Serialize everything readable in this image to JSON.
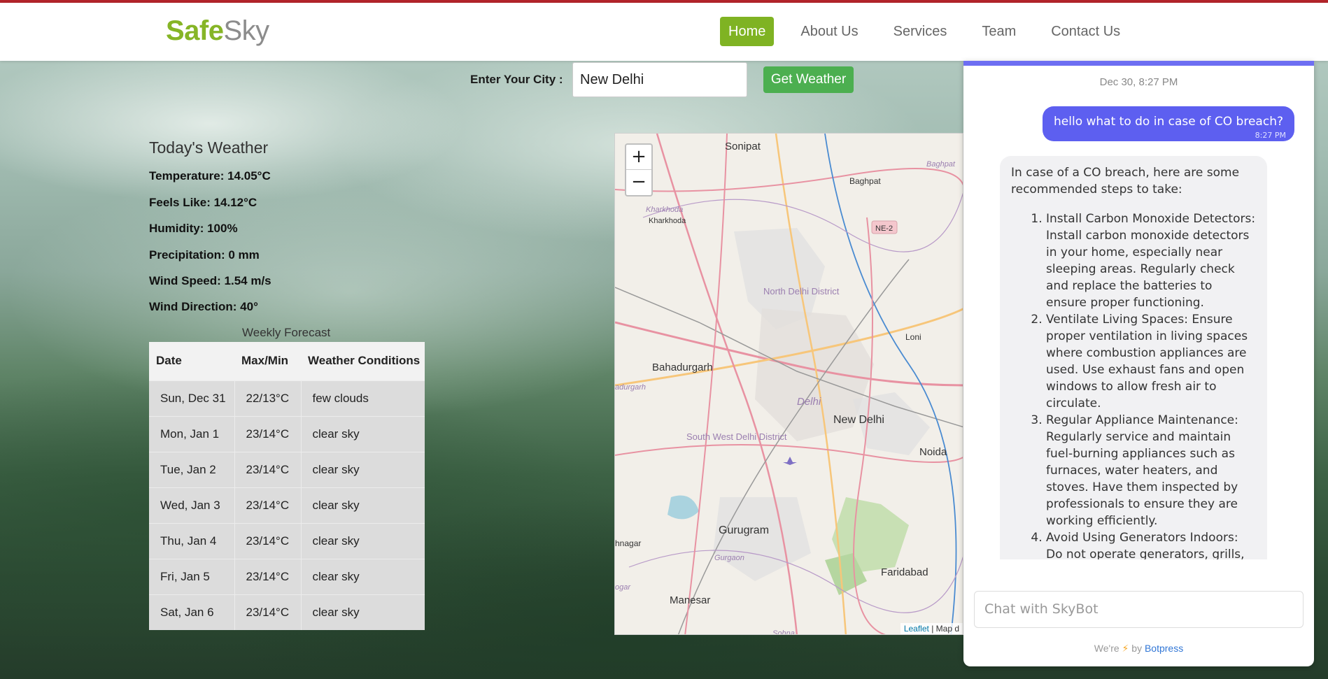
{
  "brand": {
    "part1": "Safe",
    "part2": "Sky"
  },
  "nav": {
    "items": [
      {
        "label": "Home"
      },
      {
        "label": "About Us"
      },
      {
        "label": "Services"
      },
      {
        "label": "Team"
      },
      {
        "label": "Contact Us"
      }
    ]
  },
  "search": {
    "label": "Enter Your City :",
    "value": "New Delhi",
    "button": "Get Weather"
  },
  "today": {
    "title": "Today's Weather",
    "lines": [
      "Temperature: 14.05°C",
      "Feels Like: 14.12°C",
      "Humidity: 100%",
      "Precipitation: 0 mm",
      "Wind Speed: 1.54 m/s",
      "Wind Direction: 40°"
    ]
  },
  "forecast": {
    "title": "Weekly Forecast",
    "headers": [
      "Date",
      "Max/Min",
      "Weather Conditions"
    ],
    "rows": [
      [
        "Sun, Dec 31",
        "22/13°C",
        "few clouds"
      ],
      [
        "Mon, Jan 1",
        "23/14°C",
        "clear sky"
      ],
      [
        "Tue, Jan 2",
        "23/14°C",
        "clear sky"
      ],
      [
        "Wed, Jan 3",
        "23/14°C",
        "clear sky"
      ],
      [
        "Thu, Jan 4",
        "23/14°C",
        "clear sky"
      ],
      [
        "Fri, Jan 5",
        "23/14°C",
        "clear sky"
      ],
      [
        "Sat, Jan 6",
        "23/14°C",
        "clear sky"
      ]
    ]
  },
  "map": {
    "zoom_in": "+",
    "zoom_out": "−",
    "labels": {
      "sonipat": "Sonipat",
      "baghpat": "Baghpat",
      "baghpat2": "Baghpat",
      "kharkhoda": "Kharkhoda",
      "kharkhoda2": "Kharkhoda",
      "ne2": "NE-2",
      "north_delhi": "North Delhi District",
      "loni": "Loni",
      "bahadurgarh": "Bahadurgarh",
      "adurgarh": "adurgarh",
      "delhi": "Delhi",
      "new_delhi": "New Delhi",
      "noida": "Noida",
      "south_west": "South West Delhi District",
      "gurugram": "Gurugram",
      "gurgaon": "Gurgaon",
      "hnagar": "hnagar",
      "faridabad": "Faridabad",
      "manesar": "Manesar",
      "sohna": "Sohna",
      "ogar": "ogar"
    },
    "attribution_link": "Leaflet",
    "attribution_rest": " | Map d"
  },
  "chat": {
    "date": "Dec 30, 8:27 PM",
    "user_message": "hello what to do in case of CO breach?",
    "user_time": "8:27 PM",
    "bot_intro": "In case of a CO breach, here are some recommended steps to take:",
    "bot_items": [
      "Install Carbon Monoxide Detectors: Install carbon monoxide detectors in your home, especially near sleeping areas. Regularly check and replace the batteries to ensure proper functioning.",
      "Ventilate Living Spaces: Ensure proper ventilation in living spaces where combustion appliances are used. Use exhaust fans and open windows to allow fresh air to circulate.",
      "Regular Appliance Maintenance: Regularly service and maintain fuel-burning appliances such as furnaces, water heaters, and stoves. Have them inspected by professionals to ensure they are working efficiently.",
      "Avoid Using Generators Indoors: Do not operate generators, grills, or"
    ],
    "input_placeholder": "Chat with SkyBot",
    "powered_pre": "We're",
    "powered_by": "by",
    "powered_brand": "Botpress"
  },
  "colors": {
    "brand_green": "#86b526",
    "nav_active": "#7fb323",
    "button_green": "#4caf50",
    "chat_accent": "#5d5ff0",
    "top_line": "#b3242a"
  }
}
